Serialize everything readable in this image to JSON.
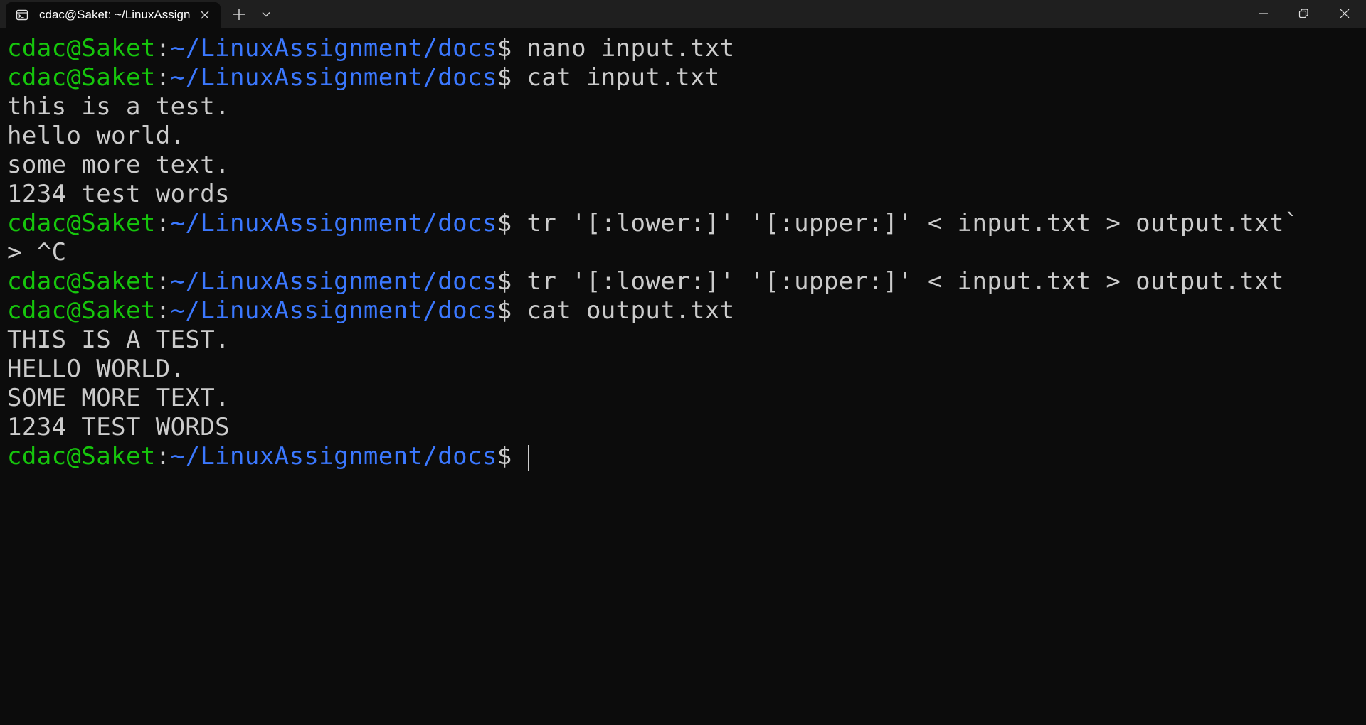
{
  "tab": {
    "title": "cdac@Saket: ~/LinuxAssignment/docs",
    "icon": "terminal-icon"
  },
  "titlebar_icons": {
    "close": "close-icon",
    "new_tab": "plus-icon",
    "dropdown": "chevron-down-icon",
    "minimize": "minimize-icon",
    "maximize": "restore-icon",
    "window_close": "close-icon"
  },
  "colors": {
    "background": "#0c0c0c",
    "titlebar": "#1f1f1f",
    "prompt_user": "#16c60c",
    "prompt_path": "#3b78ff",
    "text": "#cccccc"
  },
  "prompt": {
    "user": "cdac@Saket",
    "sep": ":",
    "path": "~/LinuxAssignment/docs",
    "dollar": "$"
  },
  "lines": [
    {
      "type": "prompt",
      "command": " nano input.txt"
    },
    {
      "type": "prompt",
      "command": " cat input.txt"
    },
    {
      "type": "output",
      "text": "this is a test."
    },
    {
      "type": "output",
      "text": "hello world."
    },
    {
      "type": "output",
      "text": "some more text."
    },
    {
      "type": "output",
      "text": "1234 test words"
    },
    {
      "type": "prompt",
      "command": " tr '[:lower:]' '[:upper:]' < input.txt > output.txt`"
    },
    {
      "type": "output",
      "text": "> ^C"
    },
    {
      "type": "prompt",
      "command": " tr '[:lower:]' '[:upper:]' < input.txt > output.txt"
    },
    {
      "type": "prompt",
      "command": " cat output.txt"
    },
    {
      "type": "output",
      "text": "THIS IS A TEST."
    },
    {
      "type": "output",
      "text": "HELLO WORLD."
    },
    {
      "type": "output",
      "text": "SOME MORE TEXT."
    },
    {
      "type": "output",
      "text": "1234 TEST WORDS"
    },
    {
      "type": "prompt",
      "command": " ",
      "cursor": true
    }
  ]
}
